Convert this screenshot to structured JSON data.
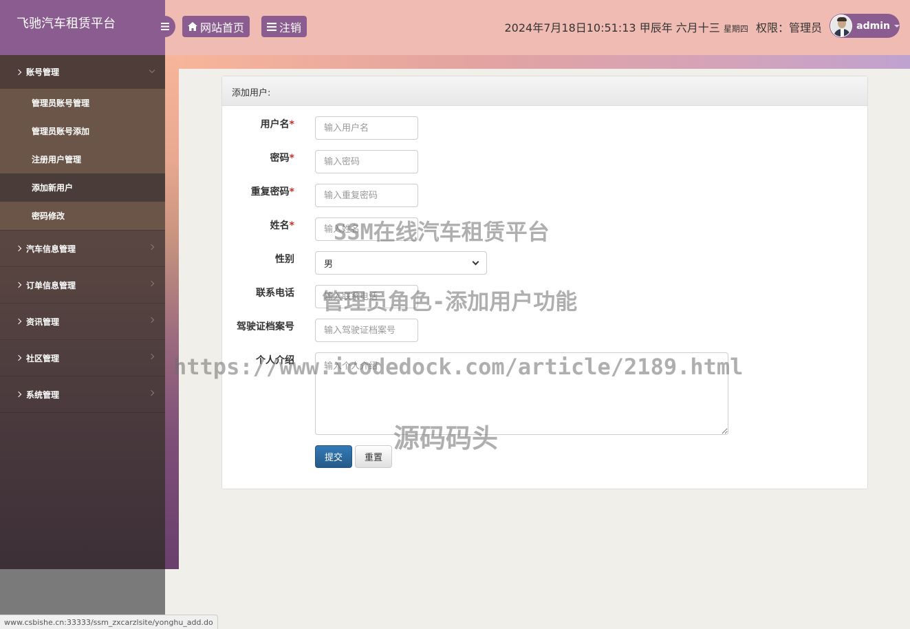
{
  "brand": {
    "title": "飞驰汽车租赁平台"
  },
  "topbar": {
    "home_label": "网站首页",
    "logout_label": "注销",
    "datetime": "2024年7月18日10:51:13 甲辰年 六月十三",
    "weekday": "星期四",
    "role": "权限：管理员",
    "username": "admin"
  },
  "sidebar": {
    "groups": [
      {
        "label": "账号管理",
        "expanded": true,
        "items": [
          {
            "label": "管理员账号管理"
          },
          {
            "label": "管理员账号添加"
          },
          {
            "label": "注册用户管理"
          },
          {
            "label": "添加新用户",
            "active": true
          },
          {
            "label": "密码修改"
          }
        ]
      },
      {
        "label": "汽车信息管理"
      },
      {
        "label": "订单信息管理"
      },
      {
        "label": "资讯管理"
      },
      {
        "label": "社区管理"
      },
      {
        "label": "系统管理"
      }
    ]
  },
  "form": {
    "title": "添加用户:",
    "fields": {
      "username": {
        "label": "用户名",
        "placeholder": "输入用户名"
      },
      "password": {
        "label": "密码",
        "placeholder": "输入密码"
      },
      "password2": {
        "label": "重复密码",
        "placeholder": "输入重复密码"
      },
      "name": {
        "label": "姓名",
        "placeholder": "输入姓名"
      },
      "gender": {
        "label": "性别",
        "value": "男"
      },
      "phone": {
        "label": "联系电话",
        "placeholder": "输入联系电话"
      },
      "license": {
        "label": "驾驶证档案号",
        "placeholder": "输入驾驶证档案号"
      },
      "intro": {
        "label": "个人介绍",
        "placeholder": "输入个人介绍"
      }
    },
    "required_mark": "*",
    "submit_label": "提交",
    "reset_label": "重置"
  },
  "watermarks": {
    "line1": "SSM在线汽车租赁平台",
    "line2": "管理员角色-添加用户功能",
    "line3": "https://www.icodedock.com/article/2189.html",
    "line4": "源码码头"
  },
  "statusbar": {
    "url": "www.csbishe.cn:33333/ssm_zxcarzlsite/yonghu_add.do"
  },
  "colors": {
    "accent": "#8b5c8f",
    "header_bg": "#f0bbb3",
    "primary_button": "#337ab7"
  }
}
